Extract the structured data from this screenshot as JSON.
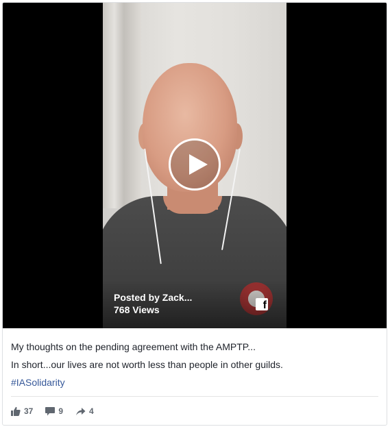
{
  "video": {
    "posted_by": "Posted by Zack...",
    "views": "768 Views",
    "play_icon": "play-icon",
    "platform_icon": "facebook-icon",
    "platform_glyph": "f"
  },
  "post": {
    "line1": "My thoughts on the pending agreement with the AMPTP...",
    "line2": "In short...our lives are not worth less than people in other guilds.",
    "hashtag": "#IASolidarity"
  },
  "stats": {
    "likes": "37",
    "comments": "9",
    "shares": "4"
  },
  "colors": {
    "link": "#365899",
    "text": "#1d2129",
    "muted": "#606770"
  }
}
